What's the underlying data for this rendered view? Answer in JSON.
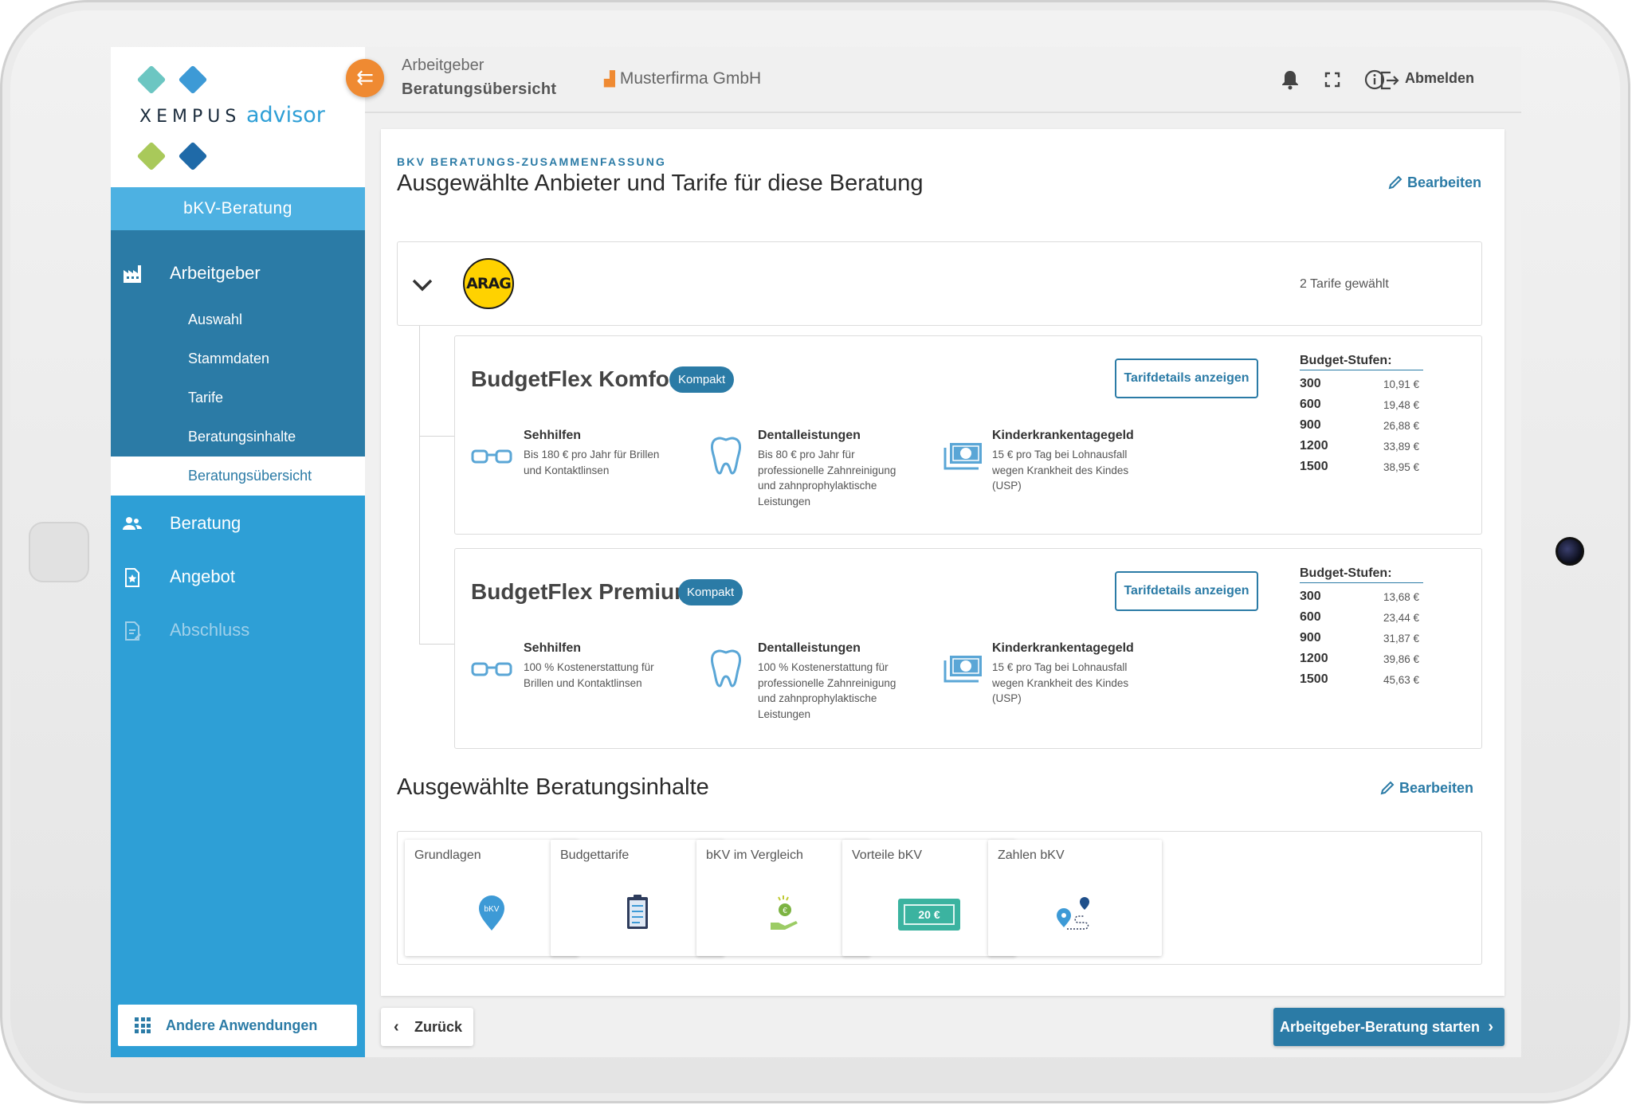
{
  "app": {
    "logo_brand": "XEMPUS",
    "logo_product": "advisor"
  },
  "sidebar": {
    "title": "bKV-Beratung",
    "sections": [
      {
        "label": "Arbeitgeber",
        "icon": "factory-icon"
      },
      {
        "label": "Beratung",
        "icon": "group-icon"
      },
      {
        "label": "Angebot",
        "icon": "document-star-icon"
      },
      {
        "label": "Abschluss",
        "icon": "document-edit-icon"
      }
    ],
    "sub_items": [
      "Auswahl",
      "Stammdaten",
      "Tarife",
      "Beratungsinhalte",
      "Beratungsübersicht"
    ],
    "active_sub_item": "Beratungsübersicht",
    "other_apps": "Andere Anwendungen"
  },
  "topbar": {
    "crumb_parent": "Arbeitgeber",
    "crumb_current": "Beratungsübersicht",
    "company": "Musterfirma GmbH",
    "logout": "Abmelden",
    "icons": [
      "bell-icon",
      "fullscreen-icon",
      "info-icon",
      "logout-icon"
    ]
  },
  "summary": {
    "overline": "BKV BERATUNGS-ZUSAMMENFASSUNG",
    "heading": "Ausgewählte Anbieter und Tarife für diese Beratung",
    "edit": "Bearbeiten"
  },
  "provider": {
    "logo_text": "ARAG",
    "tariffs_selected": "2 Tarife gewählt",
    "tariffs": [
      {
        "name": "BudgetFlex Komfort",
        "badge": "Kompakt",
        "details_button": "Tarifdetails anzeigen",
        "features": [
          {
            "title": "Sehhilfen",
            "desc": "Bis 180 € pro Jahr für Brillen und Kontaktlinsen"
          },
          {
            "title": "Dentalleistungen",
            "desc": "Bis 80 € pro Jahr für professionelle Zahnreinigung und zahnprophylaktische Leistungen"
          },
          {
            "title": "Kinderkrankentagegeld",
            "desc": "15 € pro Tag bei Lohnausfall wegen Krankheit des Kindes (USP)"
          }
        ],
        "budget_label": "Budget-Stufen:",
        "budget": [
          {
            "level": "300",
            "price": "10,91 €"
          },
          {
            "level": "600",
            "price": "19,48 €"
          },
          {
            "level": "900",
            "price": "26,88 €"
          },
          {
            "level": "1200",
            "price": "33,89 €"
          },
          {
            "level": "1500",
            "price": "38,95 €"
          }
        ]
      },
      {
        "name": "BudgetFlex Premium",
        "badge": "Kompakt",
        "details_button": "Tarifdetails anzeigen",
        "features": [
          {
            "title": "Sehhilfen",
            "desc": "100 % Kostenerstattung für Brillen und Kontaktlinsen"
          },
          {
            "title": "Dentalleistungen",
            "desc": "100 % Kostenerstattung für professionelle Zahnreinigung und zahnprophylaktische Leistungen"
          },
          {
            "title": "Kinderkrankentagegeld",
            "desc": "15 € pro Tag bei Lohnausfall wegen Krankheit des Kindes (USP)"
          }
        ],
        "budget_label": "Budget-Stufen:",
        "budget": [
          {
            "level": "300",
            "price": "13,68 €"
          },
          {
            "level": "600",
            "price": "23,44 €"
          },
          {
            "level": "900",
            "price": "31,87 €"
          },
          {
            "level": "1200",
            "price": "39,86 €"
          },
          {
            "level": "1500",
            "price": "45,63 €"
          }
        ]
      }
    ]
  },
  "contents": {
    "heading": "Ausgewählte Beratungsinhalte",
    "edit": "Bearbeiten",
    "cards": [
      {
        "title": "Grundlagen",
        "icon": "bkv-pin-icon",
        "icon_text": "bKV"
      },
      {
        "title": "Budgettarife",
        "icon": "clipboard-icon"
      },
      {
        "title": "bKV im Vergleich",
        "icon": "money-hand-icon"
      },
      {
        "title": "Vorteile bKV",
        "icon": "banknote-icon",
        "icon_text": "20 €"
      },
      {
        "title": "Zahlen bKV",
        "icon": "route-pins-icon"
      }
    ]
  },
  "footer": {
    "back": "Zurück",
    "start": "Arbeitgeber-Beratung starten"
  },
  "colors": {
    "primary": "#2b7ba6",
    "sidebar": "#2e9fd6",
    "accent": "#ef8a32",
    "arag": "#ffd200",
    "icon_blue": "#5aa6d6",
    "teal": "#3bb3a0"
  }
}
